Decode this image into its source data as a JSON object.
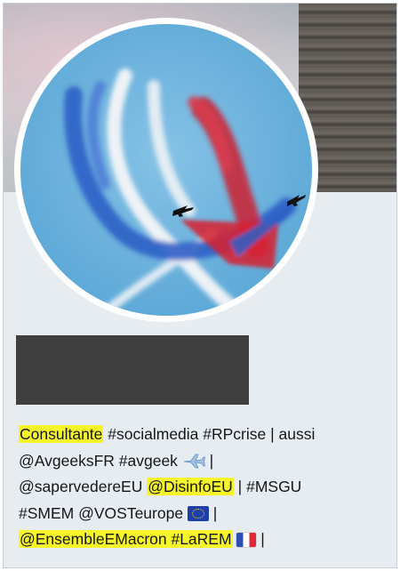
{
  "profile": {
    "bio_lines": [
      [
        {
          "text": "Consultante",
          "highlight": true
        },
        {
          "text": " #socialmedia #RPcrise | aussi",
          "highlight": false
        }
      ],
      [
        {
          "text": "@AvgeeksFR #avgeek ",
          "highlight": false
        },
        {
          "icon": "airplane-emoji-icon"
        },
        {
          "text": " |",
          "highlight": false
        }
      ],
      [
        {
          "text": "@sapervedereEU ",
          "highlight": false
        },
        {
          "text": "@DisinfoEU",
          "highlight": true
        },
        {
          "text": " | #MSGU",
          "highlight": false
        }
      ],
      [
        {
          "text": "#SMEM @VOSTeurope ",
          "highlight": false
        },
        {
          "icon": "eu-flag-emoji-icon"
        },
        {
          "text": " |",
          "highlight": false
        }
      ],
      [
        {
          "text": "@EnsembleEMacron #LaREM",
          "highlight": true
        },
        {
          "text": " ",
          "highlight": false
        },
        {
          "icon": "france-flag-emoji-icon"
        },
        {
          "text": " |",
          "highlight": false
        }
      ]
    ]
  },
  "colors": {
    "highlight": "#f5f52a",
    "profile_bg": "#e6ecf0",
    "redaction": "#3f3f3f",
    "text": "#14171a"
  }
}
